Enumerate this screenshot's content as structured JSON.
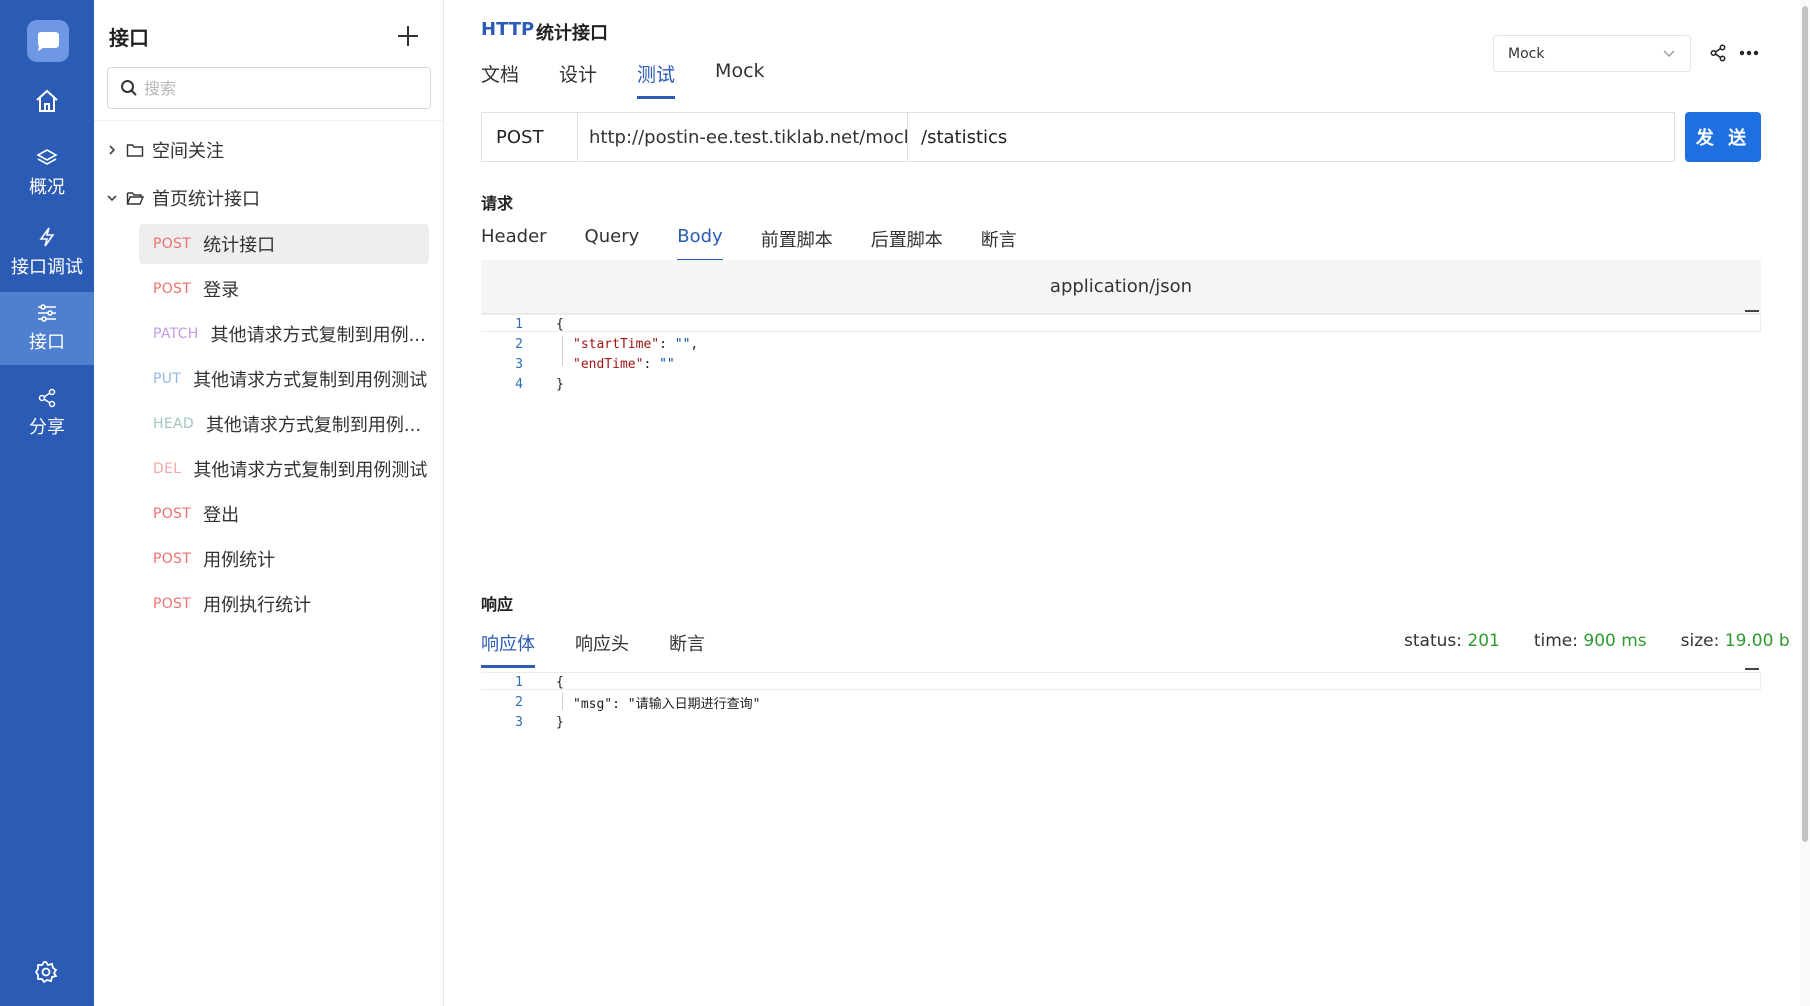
{
  "nav": {
    "items": [
      {
        "label": "",
        "icon": "home-icon"
      },
      {
        "label": "概况",
        "icon": "layers-icon"
      },
      {
        "label": "接口调试",
        "icon": "lightning-icon"
      },
      {
        "label": "接口",
        "icon": "sliders-icon"
      },
      {
        "label": "分享",
        "icon": "share-icon"
      }
    ],
    "active_index": 3
  },
  "sidebar": {
    "title": "接口",
    "search_placeholder": "搜索",
    "folders": [
      {
        "label": "空间关注",
        "expanded": false
      },
      {
        "label": "首页统计接口",
        "expanded": true
      }
    ],
    "apis": [
      {
        "method": "POST",
        "name": "统计接口",
        "color": "#f07070",
        "selected": true
      },
      {
        "method": "POST",
        "name": "登录",
        "color": "#f07070"
      },
      {
        "method": "PATCH",
        "name": "其他请求方式复制到用例...",
        "color": "#c59ae6"
      },
      {
        "method": "PUT",
        "name": "其他请求方式复制到用例测试",
        "color": "#8fb8e6"
      },
      {
        "method": "HEAD",
        "name": "其他请求方式复制到用例...",
        "color": "#9fc7c2"
      },
      {
        "method": "DEL",
        "name": "其他请求方式复制到用例测试",
        "color": "#f3a9a9"
      },
      {
        "method": "POST",
        "name": "登出",
        "color": "#f07070"
      },
      {
        "method": "POST",
        "name": "用例统计",
        "color": "#f07070"
      },
      {
        "method": "POST",
        "name": "用例执行统计",
        "color": "#f07070"
      }
    ]
  },
  "header": {
    "protocol": "HTTP",
    "api_name": "统计接口",
    "tabs": [
      "文档",
      "设计",
      "测试",
      "Mock"
    ],
    "active_tab": "测试",
    "env_select": "Mock"
  },
  "request": {
    "method": "POST",
    "base_url": "http://postin-ee.test.tiklab.net/mockx/...",
    "path": "/statistics",
    "send_label": "发 送",
    "section_label": "请求",
    "tabs": [
      "Header",
      "Query",
      "Body",
      "前置脚本",
      "后置脚本",
      "断言"
    ],
    "active_tab": "Body",
    "content_type": "application/json",
    "body_lines": [
      "{",
      "\"startTime\": \"\",",
      "\"endTime\": \"\"",
      "}"
    ]
  },
  "response": {
    "section_label": "响应",
    "tabs": [
      "响应体",
      "响应头",
      "断言"
    ],
    "active_tab": "响应体",
    "status_label": "status:",
    "status_value": "201",
    "time_label": "time:",
    "time_value": "900 ms",
    "size_label": "size:",
    "size_value": "19.00 b",
    "body_lines": [
      "{",
      "\"msg\": \"请输入日期进行查询\"",
      "}"
    ]
  },
  "colors": {
    "rail": "#2b5bb5",
    "accent": "#2b5bb5",
    "send": "#1e6fe0",
    "success": "#2f9a2f"
  }
}
